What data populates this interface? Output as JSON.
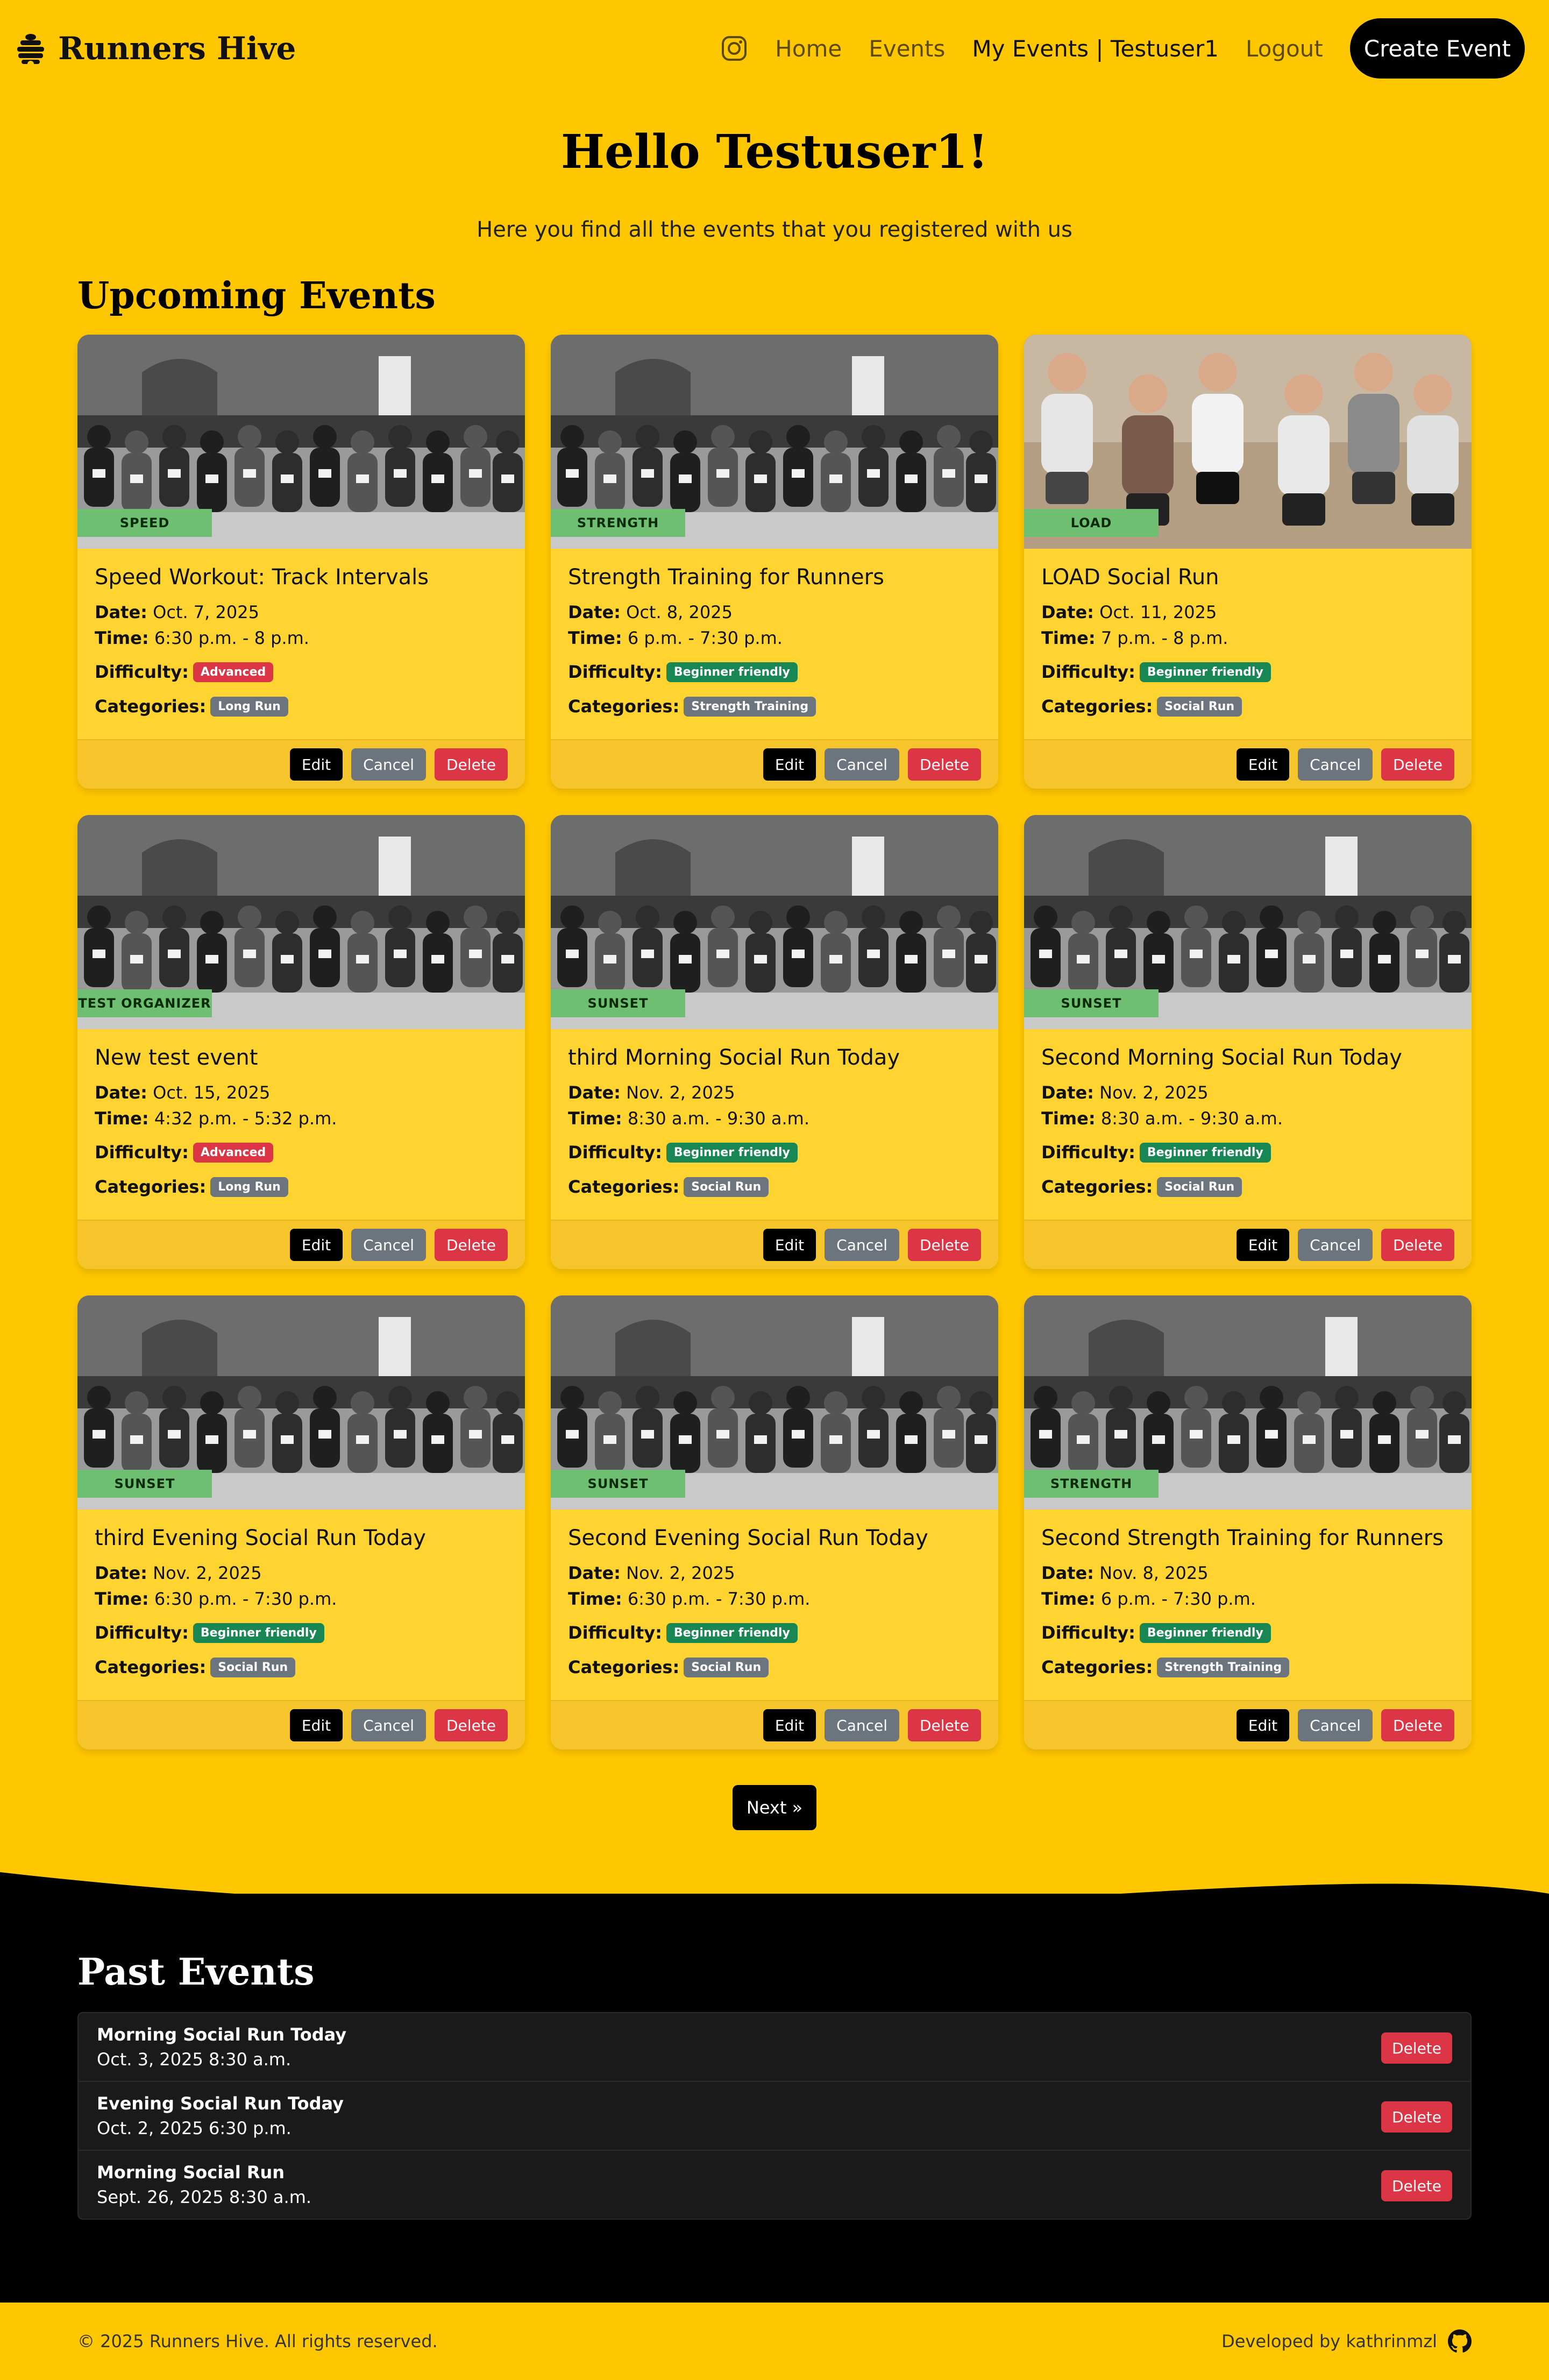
{
  "nav": {
    "brand": "Runners Hive",
    "links": [
      "Home",
      "Events",
      "My Events | Testuser1",
      "Logout"
    ],
    "create_label": "Create Event"
  },
  "hero": {
    "title": "Hello Testuser1!",
    "subtitle": "Here you find all the events that you registered with us"
  },
  "upcoming_title": "Upcoming Events",
  "labels": {
    "date": "Date:",
    "time": "Time:",
    "difficulty": "Difficulty:",
    "categories": "Categories:",
    "edit": "Edit",
    "cancel": "Cancel",
    "delete": "Delete"
  },
  "events": [
    {
      "tag": "SPEED",
      "title": "Speed Workout: Track Intervals",
      "date": "Oct. 7, 2025",
      "time": "6:30 p.m. - 8 p.m.",
      "difficulty": "Advanced",
      "difficulty_color": "#DC3545",
      "category": "Long Run",
      "image": "race"
    },
    {
      "tag": "STRENGTH",
      "title": "Strength Training for Runners",
      "date": "Oct. 8, 2025",
      "time": "6 p.m. - 7:30 p.m.",
      "difficulty": "Beginner friendly",
      "difficulty_color": "#198754",
      "category": "Strength Training",
      "image": "race"
    },
    {
      "tag": "LOAD",
      "title": "LOAD Social Run",
      "date": "Oct. 11, 2025",
      "time": "7 p.m. - 8 p.m.",
      "difficulty": "Beginner friendly",
      "difficulty_color": "#198754",
      "category": "Social Run",
      "image": "group"
    },
    {
      "tag": "TEST ORGANIZER",
      "title": "New test event",
      "date": "Oct. 15, 2025",
      "time": "4:32 p.m. - 5:32 p.m.",
      "difficulty": "Advanced",
      "difficulty_color": "#DC3545",
      "category": "Long Run",
      "image": "race"
    },
    {
      "tag": "SUNSET",
      "title": "third Morning Social Run Today",
      "date": "Nov. 2, 2025",
      "time": "8:30 a.m. - 9:30 a.m.",
      "difficulty": "Beginner friendly",
      "difficulty_color": "#198754",
      "category": "Social Run",
      "image": "race"
    },
    {
      "tag": "SUNSET",
      "title": "Second Morning Social Run Today",
      "date": "Nov. 2, 2025",
      "time": "8:30 a.m. - 9:30 a.m.",
      "difficulty": "Beginner friendly",
      "difficulty_color": "#198754",
      "category": "Social Run",
      "image": "race"
    },
    {
      "tag": "SUNSET",
      "title": "third Evening Social Run Today",
      "date": "Nov. 2, 2025",
      "time": "6:30 p.m. - 7:30 p.m.",
      "difficulty": "Beginner friendly",
      "difficulty_color": "#198754",
      "category": "Social Run",
      "image": "race"
    },
    {
      "tag": "SUNSET",
      "title": "Second Evening Social Run Today",
      "date": "Nov. 2, 2025",
      "time": "6:30 p.m. - 7:30 p.m.",
      "difficulty": "Beginner friendly",
      "difficulty_color": "#198754",
      "category": "Social Run",
      "image": "race"
    },
    {
      "tag": "STRENGTH",
      "title": "Second Strength Training for Runners",
      "date": "Nov. 8, 2025",
      "time": "6 p.m. - 7:30 p.m.",
      "difficulty": "Beginner friendly",
      "difficulty_color": "#198754",
      "category": "Strength Training",
      "image": "race"
    }
  ],
  "pagination": {
    "next_label": "Next »"
  },
  "past": {
    "title": "Past Events",
    "items": [
      {
        "name": "Morning Social Run Today",
        "datetime": "Oct. 3, 2025 8:30 a.m."
      },
      {
        "name": "Evening Social Run Today",
        "datetime": "Oct. 2, 2025 6:30 p.m."
      },
      {
        "name": "Morning Social Run",
        "datetime": "Sept. 26, 2025 8:30 a.m."
      }
    ],
    "delete_label": "Delete"
  },
  "footer": {
    "copyright": "© 2025 Runners Hive. All rights reserved.",
    "developer": "Developed by kathrinmzl"
  },
  "colors": {
    "background": "#FFC700",
    "card": "#FFD431",
    "tag_green": "#6FBF73",
    "danger": "#DC3545",
    "success": "#198754",
    "secondary": "#6C757D"
  }
}
